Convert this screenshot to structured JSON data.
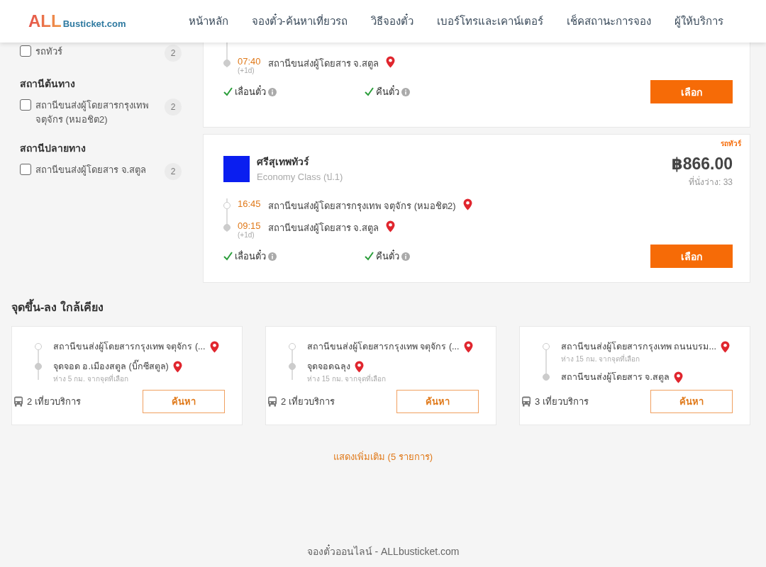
{
  "header": {
    "logo": {
      "main": "ALL",
      "sub": "Busticket.com"
    },
    "nav": [
      "หน้าหลัก",
      "จองตั๋ว-ค้นหาเที่ยวรถ",
      "วิธีจองตั๋ว",
      "เบอร์โทรและเคาน์เตอร์",
      "เช็คสถานะการจอง",
      "ผู้ให้บริการ"
    ]
  },
  "sidebar": {
    "groups": [
      {
        "options": [
          {
            "label": "รถทัวร์",
            "count": "2",
            "checked": false
          }
        ]
      },
      {
        "title": "สถานีต้นทาง",
        "options": [
          {
            "label": "สถานีขนส่งผู้โดยสารกรุงเทพ จตุจักร (หมอชิต2)",
            "count": "2",
            "checked": false
          }
        ]
      },
      {
        "title": "สถานีปลายทาง",
        "options": [
          {
            "label": "สถานีขนส่งผู้โดยสาร จ.สตูล",
            "count": "2",
            "checked": false
          }
        ]
      }
    ]
  },
  "trips": [
    {
      "stops": [
        {
          "time": "07:40",
          "station": "สถานีขนส่งผู้โดยสาร จ.สตูล",
          "next_day": "(+1d)"
        }
      ],
      "features": [
        {
          "label": "เลื่อนตั๋ว",
          "available": true
        },
        {
          "label": "คืนตั๋ว",
          "available": true
        }
      ],
      "button": "เลือก"
    },
    {
      "badge": "รถทัวร์",
      "operator": "ศรีสุเทพทัวร์",
      "class": "Economy Class (ป.1)",
      "price": "฿866.00",
      "seats": "ที่นั่งว่าง: 33",
      "stops": [
        {
          "time": "16:45",
          "station": "สถานีขนส่งผู้โดยสารกรุงเทพ จตุจักร (หมอชิต2)"
        },
        {
          "time": "09:15",
          "station": "สถานีขนส่งผู้โดยสาร จ.สตูล",
          "next_day": "(+1d)"
        }
      ],
      "features": [
        {
          "label": "เลื่อนตั๋ว",
          "available": true
        },
        {
          "label": "คืนตั๋ว",
          "available": true
        }
      ],
      "button": "เลือก"
    }
  ],
  "nearby": {
    "title": "จุดขึ้น-ลง ใกล้เคียง",
    "routes": [
      {
        "stops": [
          {
            "name": "สถานีขนส่งผู้โดยสารกรุงเทพ จตุจักร (..."
          },
          {
            "name": "จุดจอด อ.เมืองสตูล (บิ๊กซีสตูล)",
            "distance": "ห่าง 5 กม. จากจุดที่เลือก"
          }
        ],
        "trips": "2 เที่ยวบริการ",
        "button": "ค้นหา"
      },
      {
        "stops": [
          {
            "name": "สถานีขนส่งผู้โดยสารกรุงเทพ จตุจักร (..."
          },
          {
            "name": "จุดจอดฉลุง",
            "distance": "ห่าง 15 กม. จากจุดที่เลือก"
          }
        ],
        "trips": "2 เที่ยวบริการ",
        "button": "ค้นหา"
      },
      {
        "stops": [
          {
            "name": "สถานีขนส่งผู้โดยสารกรุงเทพ ถนนบรม...",
            "distance": "ห่าง 15 กม. จากจุดที่เลือก"
          },
          {
            "name": "สถานีขนส่งผู้โดยสาร จ.สตูล"
          }
        ],
        "trips": "3 เที่ยวบริการ",
        "button": "ค้นหา"
      }
    ]
  },
  "show_more": "แสดงเพิ่มเติม (5 รายการ)",
  "footer": "จองตั๋วออนไลน์ - ALLbusticket.com"
}
